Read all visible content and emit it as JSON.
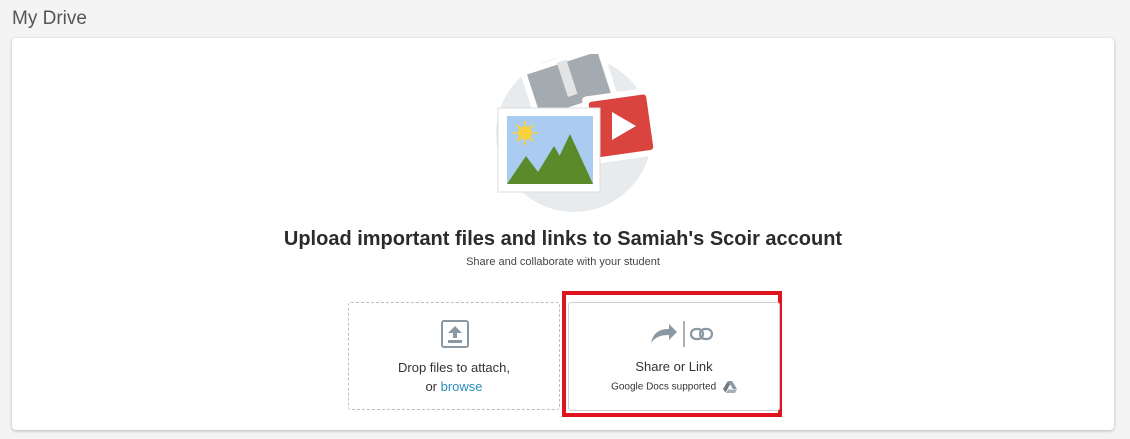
{
  "page": {
    "title": "My Drive"
  },
  "upload": {
    "headline": "Upload important files and links to Samiah's Scoir account",
    "subline": "Share and collaborate with your student"
  },
  "dropzone": {
    "line1": "Drop files to attach,",
    "line2_prefix": "or ",
    "browse_label": "browse"
  },
  "share": {
    "label": "Share or Link",
    "sub": "Google Docs supported"
  },
  "colors": {
    "accent_link": "#2a8fbd",
    "highlight_border": "#e0141e",
    "video_red": "#d9443f",
    "mountain_green": "#5a8a2a",
    "sky_blue": "#a9ccf0"
  },
  "icons": [
    "upload-icon",
    "share-arrow-icon",
    "link-icon",
    "google-drive-icon",
    "image-icon",
    "video-play-icon",
    "zip-file-icon"
  ]
}
